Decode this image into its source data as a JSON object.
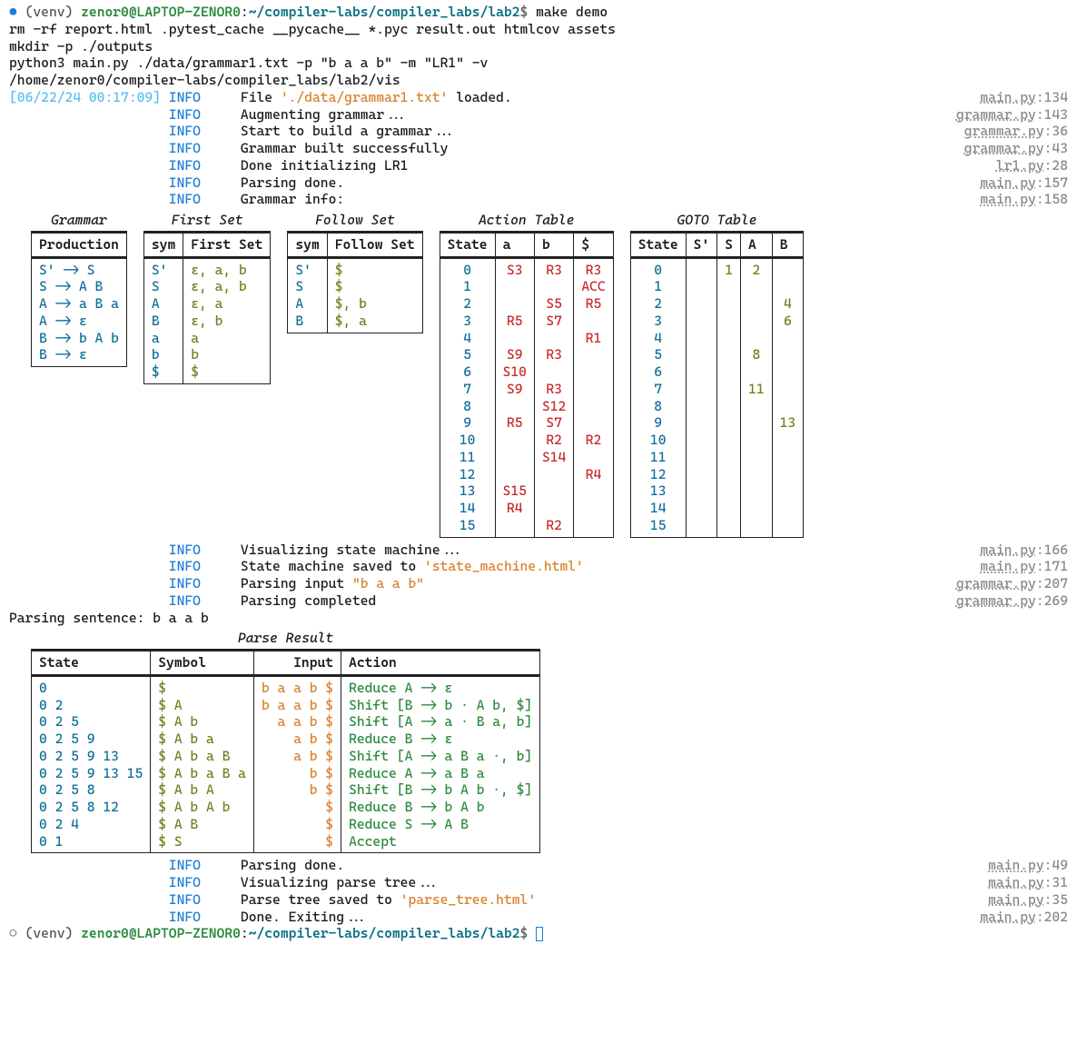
{
  "prompt1": {
    "venv": "(venv) ",
    "user": "zenor0@LAPTOP-ZENOR0",
    "sep": ":",
    "path": "~/compiler-labs/compiler_labs/lab2",
    "dollar": "$ ",
    "cmd": "make demo"
  },
  "pre_lines": [
    "rm -rf report.html .pytest_cache __pycache__ *.pyc result.out htmlcov assets",
    "mkdir -p ./outputs",
    "python3 main.py ./data/grammar1.txt -p \"b a a b\" -m \"LR1\" -v",
    "/home/zenor0/compiler-labs/compiler_labs/lab2/vis"
  ],
  "ts": "[06/22/24 00:17:09]",
  "logs1": [
    {
      "msg_pre": "File ",
      "str": "'./data/grammar1.txt'",
      "msg_post": " loaded.",
      "src": "main.py",
      "line": "134"
    },
    {
      "msg_pre": "Augmenting grammar...",
      "str": "",
      "msg_post": "",
      "src": "grammar.py",
      "line": "143"
    },
    {
      "msg_pre": "Start to build a grammar...",
      "str": "",
      "msg_post": "",
      "src": "grammar.py",
      "line": "36"
    },
    {
      "msg_pre": "Grammar built successfully",
      "str": "",
      "msg_post": "",
      "src": "grammar.py",
      "line": "43"
    },
    {
      "msg_pre": "Done initializing LR1",
      "str": "",
      "msg_post": "",
      "src": "lr1.py",
      "line": "28"
    },
    {
      "msg_pre": "Parsing done.",
      "str": "",
      "msg_post": "",
      "src": "main.py",
      "line": "157"
    },
    {
      "msg_pre": "Grammar info:",
      "str": "",
      "msg_post": "",
      "src": "main.py",
      "line": "158"
    }
  ],
  "grammar": {
    "title": "Grammar",
    "header": "Production",
    "rows": [
      "S' -> S",
      "S -> A B",
      "A -> a B a",
      "A -> ε",
      "B -> b A b",
      "B -> ε"
    ]
  },
  "first": {
    "title": "First Set",
    "headers": [
      "sym",
      "First Set"
    ],
    "rows": [
      [
        "S'",
        "ε, a, b"
      ],
      [
        "S",
        "ε, a, b"
      ],
      [
        "A",
        "ε, a"
      ],
      [
        "B",
        "ε, b"
      ],
      [
        "a",
        "a"
      ],
      [
        "b",
        "b"
      ],
      [
        "$",
        "$"
      ]
    ]
  },
  "follow": {
    "title": "Follow Set",
    "headers": [
      "sym",
      "Follow Set"
    ],
    "rows": [
      [
        "S'",
        "$"
      ],
      [
        "S",
        "$"
      ],
      [
        "A",
        "$, b"
      ],
      [
        "B",
        "$, a"
      ]
    ]
  },
  "action": {
    "title": "Action Table",
    "headers": [
      "State",
      "a",
      "b",
      "$"
    ],
    "rows": [
      [
        "0",
        "S3",
        "R3",
        "R3"
      ],
      [
        "1",
        "",
        "",
        "ACC"
      ],
      [
        "2",
        "",
        "S5",
        "R5"
      ],
      [
        "3",
        "R5",
        "S7",
        ""
      ],
      [
        "4",
        "",
        "",
        "R1"
      ],
      [
        "5",
        "S9",
        "R3",
        ""
      ],
      [
        "6",
        "S10",
        "",
        ""
      ],
      [
        "7",
        "S9",
        "R3",
        ""
      ],
      [
        "8",
        "",
        "S12",
        ""
      ],
      [
        "9",
        "R5",
        "S7",
        ""
      ],
      [
        "10",
        "",
        "R2",
        "R2"
      ],
      [
        "11",
        "",
        "S14",
        ""
      ],
      [
        "12",
        "",
        "",
        "R4"
      ],
      [
        "13",
        "S15",
        "",
        ""
      ],
      [
        "14",
        "R4",
        "",
        ""
      ],
      [
        "15",
        "",
        "R2",
        ""
      ]
    ]
  },
  "goto": {
    "title": "GOTO Table",
    "headers": [
      "State",
      "S'",
      "S",
      "A",
      "B"
    ],
    "rows": [
      [
        "0",
        "",
        "1",
        "2",
        ""
      ],
      [
        "1",
        "",
        "",
        "",
        ""
      ],
      [
        "2",
        "",
        "",
        "",
        "4"
      ],
      [
        "3",
        "",
        "",
        "",
        "6"
      ],
      [
        "4",
        "",
        "",
        "",
        ""
      ],
      [
        "5",
        "",
        "",
        "8",
        ""
      ],
      [
        "6",
        "",
        "",
        "",
        ""
      ],
      [
        "7",
        "",
        "",
        "11",
        ""
      ],
      [
        "8",
        "",
        "",
        "",
        ""
      ],
      [
        "9",
        "",
        "",
        "",
        "13"
      ],
      [
        "10",
        "",
        "",
        "",
        ""
      ],
      [
        "11",
        "",
        "",
        "",
        ""
      ],
      [
        "12",
        "",
        "",
        "",
        ""
      ],
      [
        "13",
        "",
        "",
        "",
        ""
      ],
      [
        "14",
        "",
        "",
        "",
        ""
      ],
      [
        "15",
        "",
        "",
        "",
        ""
      ]
    ]
  },
  "logs2": [
    {
      "msg_pre": "Visualizing state machine...",
      "str": "",
      "msg_post": "",
      "src": "main.py",
      "line": "166"
    },
    {
      "msg_pre": "State machine saved to ",
      "str": "'state_machine.html'",
      "msg_post": "",
      "src": "main.py",
      "line": "171"
    },
    {
      "msg_pre": "Parsing input ",
      "str": "\"b a a b\"",
      "msg_post": "",
      "src": "grammar.py",
      "line": "207"
    },
    {
      "msg_pre": "Parsing completed",
      "str": "",
      "msg_post": "",
      "src": "grammar.py",
      "line": "269"
    }
  ],
  "parsing_sentence": "Parsing sentence: b a a b",
  "parse": {
    "title": "Parse Result",
    "headers": [
      "State",
      "Symbol",
      "Input",
      "Action"
    ],
    "rows": [
      [
        "0",
        "$",
        "b a a b $",
        "Reduce A -> ε"
      ],
      [
        "0 2",
        "$ A",
        "b a a b $",
        "Shift [B -> b · A b, $]"
      ],
      [
        "0 2 5",
        "$ A b",
        "a a b $",
        "Shift [A -> a · B a, b]"
      ],
      [
        "0 2 5 9",
        "$ A b a",
        "a b $",
        "Reduce B -> ε"
      ],
      [
        "0 2 5 9 13",
        "$ A b a B",
        "a b $",
        "Shift [A -> a B a ·, b]"
      ],
      [
        "0 2 5 9 13 15",
        "$ A b a B a",
        "b $",
        "Reduce A -> a B a"
      ],
      [
        "0 2 5 8",
        "$ A b A",
        "b $",
        "Shift [B -> b A b ·, $]"
      ],
      [
        "0 2 5 8 12",
        "$ A b A b",
        "$",
        "Reduce B -> b A b"
      ],
      [
        "0 2 4",
        "$ A B",
        "$",
        "Reduce S -> A B"
      ],
      [
        "0 1",
        "$ S",
        "$",
        "Accept"
      ]
    ]
  },
  "logs3": [
    {
      "msg_pre": "Parsing done.",
      "str": "",
      "msg_post": "",
      "src": "main.py",
      "line": "49"
    },
    {
      "msg_pre": "Visualizing parse tree...",
      "str": "",
      "msg_post": "",
      "src": "main.py",
      "line": "31"
    },
    {
      "msg_pre": "Parse tree saved to ",
      "str": "'parse_tree.html'",
      "msg_post": "",
      "src": "main.py",
      "line": "35"
    },
    {
      "msg_pre": "Done. Exiting...",
      "str": "",
      "msg_post": "",
      "src": "main.py",
      "line": "202"
    }
  ],
  "prompt2": {
    "venv": "(venv) ",
    "user": "zenor0@LAPTOP-ZENOR0",
    "sep": ":",
    "path": "~/compiler-labs/compiler_labs/lab2",
    "dollar": "$ "
  },
  "info_label": "INFO"
}
